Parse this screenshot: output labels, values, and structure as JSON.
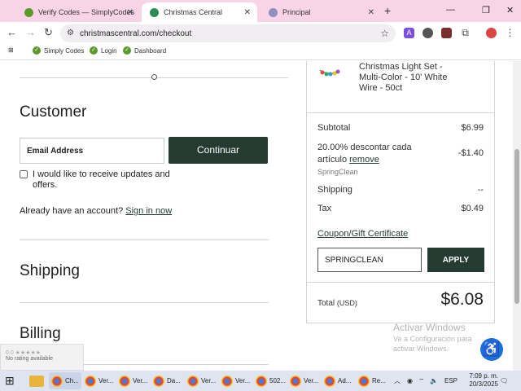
{
  "browser": {
    "tabs": [
      {
        "label": "Verify Codes — SimplyCodes",
        "fav_color": "#5a9a2a"
      },
      {
        "label": "Christmas Central",
        "fav_color": "#2e8b57"
      },
      {
        "label": "Principal",
        "fav_color": "#8e8ec0"
      }
    ],
    "new_tab": "+",
    "close_glyph": "✕",
    "url": "christmascentral.com/checkout",
    "bookmarks": [
      {
        "label": "Simply Codes"
      },
      {
        "label": "Login"
      },
      {
        "label": "Dashboard"
      }
    ]
  },
  "checkout": {
    "customer_heading": "Customer",
    "email_placeholder": "Email Address",
    "continue_label": "Continuar",
    "updates_label": "I would like to receive updates and offers.",
    "account_text": "Already have an account?",
    "sign_in_link": "Sign in now",
    "shipping_heading": "Shipping",
    "billing_heading": "Billing"
  },
  "summary": {
    "product_name": "Christmas Light Set - Multi-Color - 10' White Wire - 50ct",
    "subtotal_label": "Subtotal",
    "subtotal_value": "$6.99",
    "discount_label": "20.00% descontar cada artículo",
    "remove_link": "remove",
    "discount_code": "SpringClean",
    "discount_value": "-$1.40",
    "shipping_label": "Shipping",
    "shipping_value": "--",
    "tax_label": "Tax",
    "tax_value": "$0.49",
    "coupon_link": "Coupon/Gift Certificate",
    "coupon_value": "SPRINGCLEAN",
    "apply_label": "APPLY",
    "total_label": "Total",
    "total_currency": "(USD)",
    "total_value": "$6.08"
  },
  "overlay": {
    "watermark_title": "Activar Windows",
    "watermark_sub": "Ve a Configuración para activar Windows.",
    "rating_stars": "0.0 ★★★★★",
    "rating_text": "No rating available"
  },
  "taskbar": {
    "items": [
      "Ch...",
      "Ver...",
      "Ver...",
      "Da...",
      "Ver...",
      "Ver...",
      "502...",
      "Ver...",
      "Ad...",
      "Re..."
    ],
    "language": "ESP",
    "time": "7:09 p. m.",
    "date": "20/3/2025"
  },
  "colors": {
    "accent": "#253b32",
    "tabstrip": "#f9d4e6"
  }
}
